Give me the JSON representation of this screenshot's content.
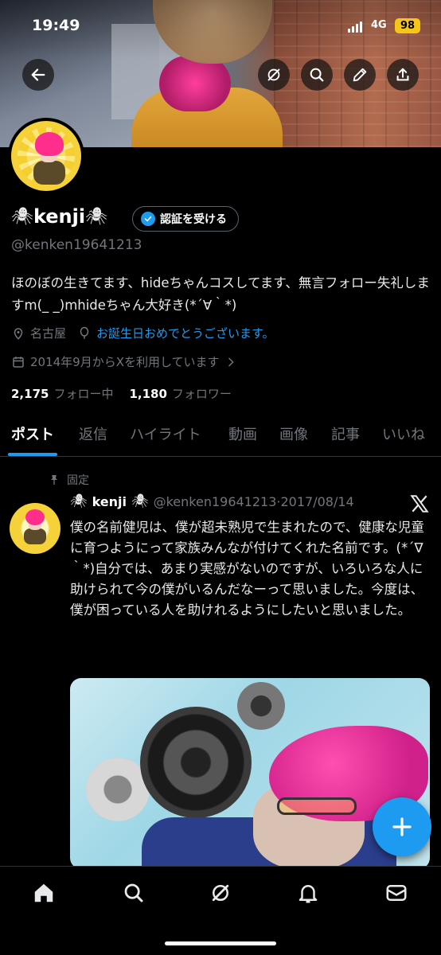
{
  "status_bar": {
    "time": "19:49",
    "network": "4G",
    "battery": "98"
  },
  "profile": {
    "name": "kenji",
    "name_decoration": "🕷",
    "verify_button": "認証を受ける",
    "handle": "@kenken19641213",
    "bio": "ほのぼの生きてます、hideちゃんコスしてます、無言フォロー失礼しますm(_ _)mhideちゃん大好き(*´∀｀*)",
    "location": "名古屋",
    "birthday": "お誕生日おめでとうございます。",
    "joined": "2014年9月からXを利用しています",
    "following_count": "2,175",
    "following_label": "フォロー中",
    "followers_count": "1,180",
    "followers_label": "フォロワー"
  },
  "tabs": [
    "ポスト",
    "返信",
    "ハイライト",
    "動画",
    "画像",
    "記事",
    "いいね"
  ],
  "pinned_post": {
    "pinned_label": "固定",
    "author_name": "kenji",
    "author_handle": "@kenken19641213",
    "date": "·2017/08/14",
    "text": "僕の名前健児は、僕が超未熟児で生まれたので、健康な児童に育つようにって家族みんなが付けてくれた名前です。(*´∇｀*)自分では、あまり実感がないのですが、いろいろな人に助けられて今の僕がいるんだなーって思いました。今度は、僕が困っている人を助けれるようにしたいと思いました。"
  },
  "icons": {
    "back": "back-arrow-icon",
    "grok": "grok-icon",
    "search": "search-icon",
    "edit": "pencil-icon",
    "share": "share-icon",
    "compose": "plus-icon",
    "nav": [
      "home-icon",
      "search-icon",
      "grok-icon",
      "bell-icon",
      "mail-icon"
    ]
  },
  "colors": {
    "accent": "#1d9bf0",
    "background": "#000000",
    "muted": "#71767b",
    "battery": "#f5c518"
  }
}
